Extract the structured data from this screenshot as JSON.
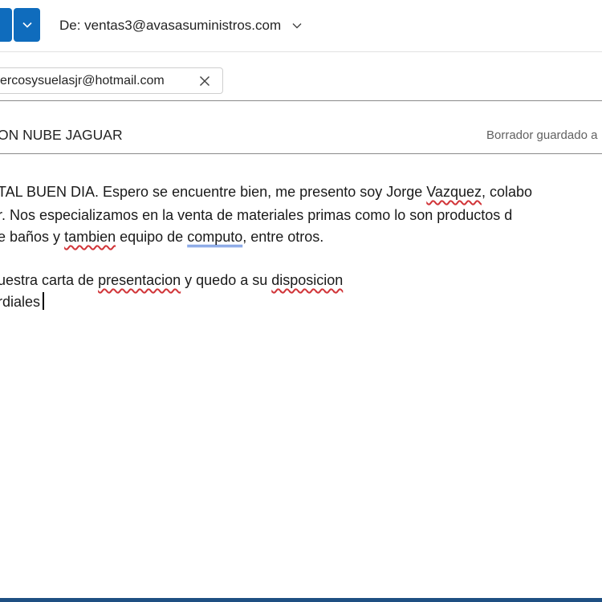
{
  "from": {
    "label": "De: ventas3@avasasuministros.com"
  },
  "recipients": [
    {
      "address": "ercosysuelasjr@hotmail.com"
    }
  ],
  "subject": "ON NUBE JAGUAR",
  "draft_status": "Borrador guardado a",
  "body": {
    "l1a": "TAL BUEN DIA. Espero se encuentre bien, me presento soy Jorge ",
    "l1sp": "Vazquez",
    "l1b": ", colabo",
    "l2": "r. Nos especializamos en la venta de materiales primas como lo son productos d",
    "l3a": "e baños y ",
    "l3sp": "tambien",
    "l3b": " equipo de ",
    "l3gr": "computo",
    "l3c": ", entre otros.",
    "l4a": "uestra carta de ",
    "l4sp1": "presentacion",
    "l4b": " y quedo a su ",
    "l4sp2": "disposicion",
    "l5": "rdiales"
  },
  "colors": {
    "accent": "#0f6cbd",
    "spell_error": "#d13438",
    "grammar": "#3b6fd6",
    "taskbar": "#1e4f82"
  },
  "icons": {
    "send_dropdown": "chevron-down-icon",
    "from_dropdown": "chevron-down-icon",
    "remove_recipient": "close-icon"
  }
}
